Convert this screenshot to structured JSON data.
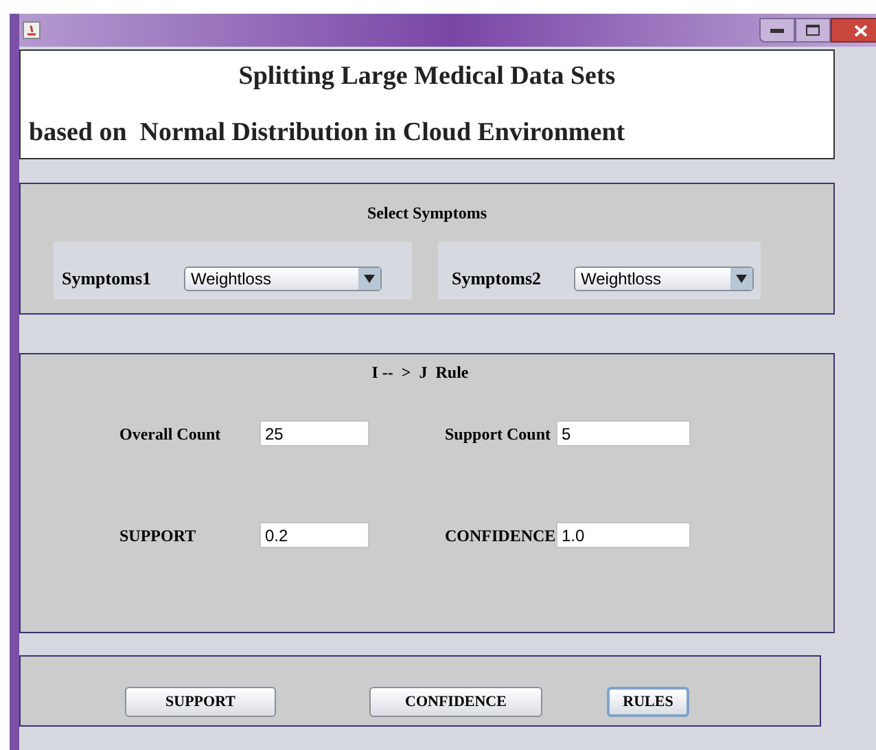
{
  "window": {
    "title_lines": [
      "Splitting Large Medical Data Sets",
      "based on  Normal Distribution in Cloud Environment"
    ]
  },
  "symptoms_panel": {
    "heading": "Select Symptoms",
    "selectors": [
      {
        "label": "Symptoms1",
        "value": "Weightloss"
      },
      {
        "label": "Symptoms2",
        "value": "Weightloss"
      }
    ]
  },
  "rule_panel": {
    "heading": "I --  >  J  Rule",
    "fields": [
      {
        "label": "Overall Count",
        "value": "25"
      },
      {
        "label": "Support Count",
        "value": "5"
      },
      {
        "label": "SUPPORT",
        "value": "0.2"
      },
      {
        "label": "CONFIDENCE",
        "value": "1.0"
      }
    ]
  },
  "buttons": [
    {
      "label": "SUPPORT",
      "focused": false
    },
    {
      "label": "CONFIDENCE",
      "focused": false
    },
    {
      "label": "RULES",
      "focused": true
    }
  ]
}
